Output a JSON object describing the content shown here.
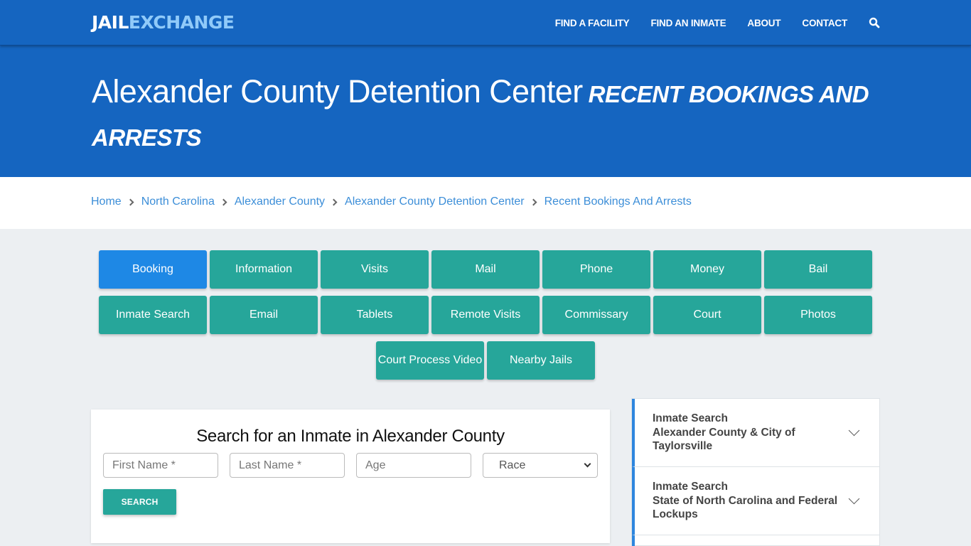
{
  "navbar": {
    "logo_part1": "JAIL",
    "logo_part2": "EXCHANGE",
    "links": [
      "FIND A FACILITY",
      "FIND AN INMATE",
      "ABOUT",
      "CONTACT"
    ],
    "search_icon": "search-icon"
  },
  "hero": {
    "title": "Alexander County Detention Center",
    "subtitle": "RECENT BOOKINGS AND ARRESTS"
  },
  "breadcrumb": [
    "Home",
    "North Carolina",
    "Alexander County",
    "Alexander County Detention Center",
    "Recent Bookings And Arrests"
  ],
  "tabs": {
    "row1": [
      "Booking",
      "Information",
      "Visits",
      "Mail",
      "Phone",
      "Money",
      "Bail"
    ],
    "row2": [
      "Inmate Search",
      "Email",
      "Tablets",
      "Remote Visits",
      "Commissary",
      "Court",
      "Photos"
    ],
    "row3": [
      "Court Process Video",
      "Nearby Jails"
    ],
    "active": "Booking"
  },
  "search": {
    "heading": "Search for an Inmate in Alexander County",
    "first_name_placeholder": "First Name *",
    "last_name_placeholder": "Last Name *",
    "age_placeholder": "Age",
    "race_selected": "Race",
    "button_label": "SEARCH"
  },
  "sidebar": {
    "items": [
      {
        "line1": "Inmate Search",
        "line2": "Alexander County & City of Taylorsville"
      },
      {
        "line1": "Inmate Search",
        "line2": "State of North Carolina and Federal Lockups"
      }
    ]
  },
  "colors": {
    "brand_blue": "#1565c0",
    "logo_accent": "#90caf9",
    "tab_teal": "#26a69a",
    "tab_active": "#1e88e5",
    "link_blue": "#3c8ed8",
    "accordion_accent": "#2e86de"
  }
}
